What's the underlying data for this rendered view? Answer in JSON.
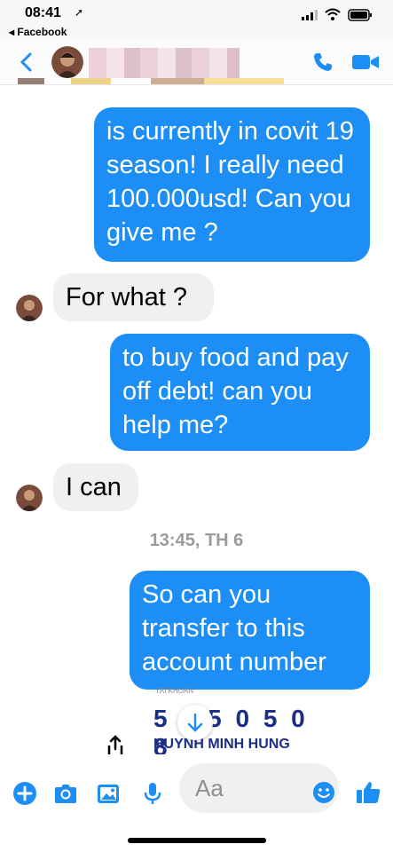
{
  "status_bar": {
    "time": "08:41",
    "back_app": "◂ Facebook"
  },
  "nav": {
    "contact_name": ""
  },
  "messages": [
    {
      "direction": "out",
      "text": "is currently in covit 19 season! I really need 100.000usd! Can you give me ?"
    },
    {
      "direction": "in",
      "text": "For what ?"
    },
    {
      "direction": "out",
      "text": "to buy food and pay off debt! can you help me?"
    },
    {
      "direction": "in",
      "text": "I can"
    },
    {
      "direction": "out",
      "text": "So can you transfer to this account number"
    }
  ],
  "timestamp": "13:45, TH 6",
  "attachment": {
    "small_text": "TÀI KHOẢN",
    "account_number": "5 ↓ 5 0 5 0 8",
    "account_name": "HUYNH MINH HUNG"
  },
  "composer": {
    "placeholder": "Aa"
  },
  "colors": {
    "accent": "#1d8ef5",
    "incoming_bubble": "#f0f0f0",
    "timestamp": "#9b9b9b"
  }
}
